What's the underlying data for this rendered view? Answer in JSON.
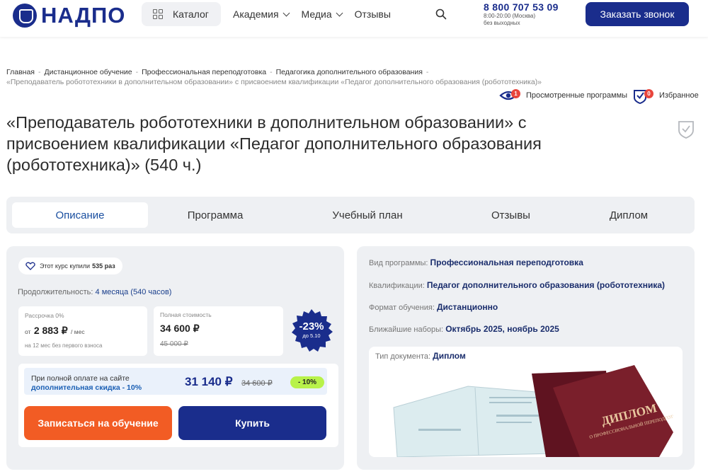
{
  "header": {
    "logo_text": "НАДПО",
    "catalog_label": "Каталог",
    "nav": [
      {
        "label": "Академия",
        "has_dropdown": true
      },
      {
        "label": "Медиа",
        "has_dropdown": true
      },
      {
        "label": "Отзывы",
        "has_dropdown": false
      }
    ],
    "phone": "8 800 707 53 09",
    "hours": "8:00-20:00 (Москва)",
    "days": "без выходных",
    "call_button": "Заказать звонок"
  },
  "breadcrumb": {
    "items": [
      "Главная",
      "Дистанционное обучение",
      "Профессиональная переподготовка",
      "Педагогика дополнительного образования"
    ],
    "current": "«Преподаватель робототехники в дополнительном образовании» с присвоением квалификации «Педагог дополнительного образования (робототехника)»"
  },
  "user_links": {
    "viewed_label": "Просмотренные программы",
    "viewed_count": "1",
    "favorites_label": "Избранное",
    "favorites_count": "0"
  },
  "page_title": "«Преподаватель робототехники в дополнительном образовании» с присвоением квалификации «Педагог дополнительного образования (робототехника)» (540 ч.)",
  "tabs": [
    {
      "label": "Описание",
      "active": true
    },
    {
      "label": "Программа",
      "active": false
    },
    {
      "label": "Учебный план",
      "active": false
    },
    {
      "label": "Отзывы",
      "active": false
    },
    {
      "label": "Диплом",
      "active": false
    }
  ],
  "pricing": {
    "bought_prefix": "Этот курс купили",
    "bought_count": "535 раз",
    "duration_label": "Продолжительность:",
    "duration_value": "4 месяца (540 часов)",
    "installment_label": "Рассрочка 0%",
    "installment_from": "от",
    "installment_price": "2 883 ₽",
    "installment_period": "/ мес",
    "installment_note": "на 12 мес без первого взноса",
    "full_label": "Полная стоимость",
    "full_price": "34 600 ₽",
    "full_old_price": "45 000 ₽",
    "discount_pct": "-23%",
    "discount_until": "до 5.10",
    "full_pay_text": "При полной оплате на сайте",
    "full_pay_accent": "дополнительная скидка - 10%",
    "final_price": "31 140 ₽",
    "final_old_price": "34 600 ₽",
    "final_badge": "- 10%",
    "enroll_button": "Записаться на обучение",
    "buy_button": "Купить"
  },
  "program_info": {
    "type_label": "Вид программы:",
    "type_value": "Профессиональная переподготовка",
    "qualification_label": "Квалификации:",
    "qualification_value": "Педагог дополнительного образования (робототехника)",
    "format_label": "Формат обучения:",
    "format_value": "Дистанционно",
    "enrollment_label": "Ближайшие наборы:",
    "enrollment_value": "Октябрь 2025, ноябрь 2025",
    "doc_label": "Тип документа:",
    "doc_value": "Диплом",
    "diploma_cover_text": "ДИПЛОМ",
    "diploma_sub": "О ПРОФЕССИОНАЛЬНОЙ ПЕРЕПОДГОТОВКЕ"
  },
  "colors": {
    "brand": "#1a2d8c",
    "orange": "#f25c24",
    "lime": "#b8f24a",
    "badge_red": "#e8453c",
    "diploma": "#7a1f2b"
  }
}
